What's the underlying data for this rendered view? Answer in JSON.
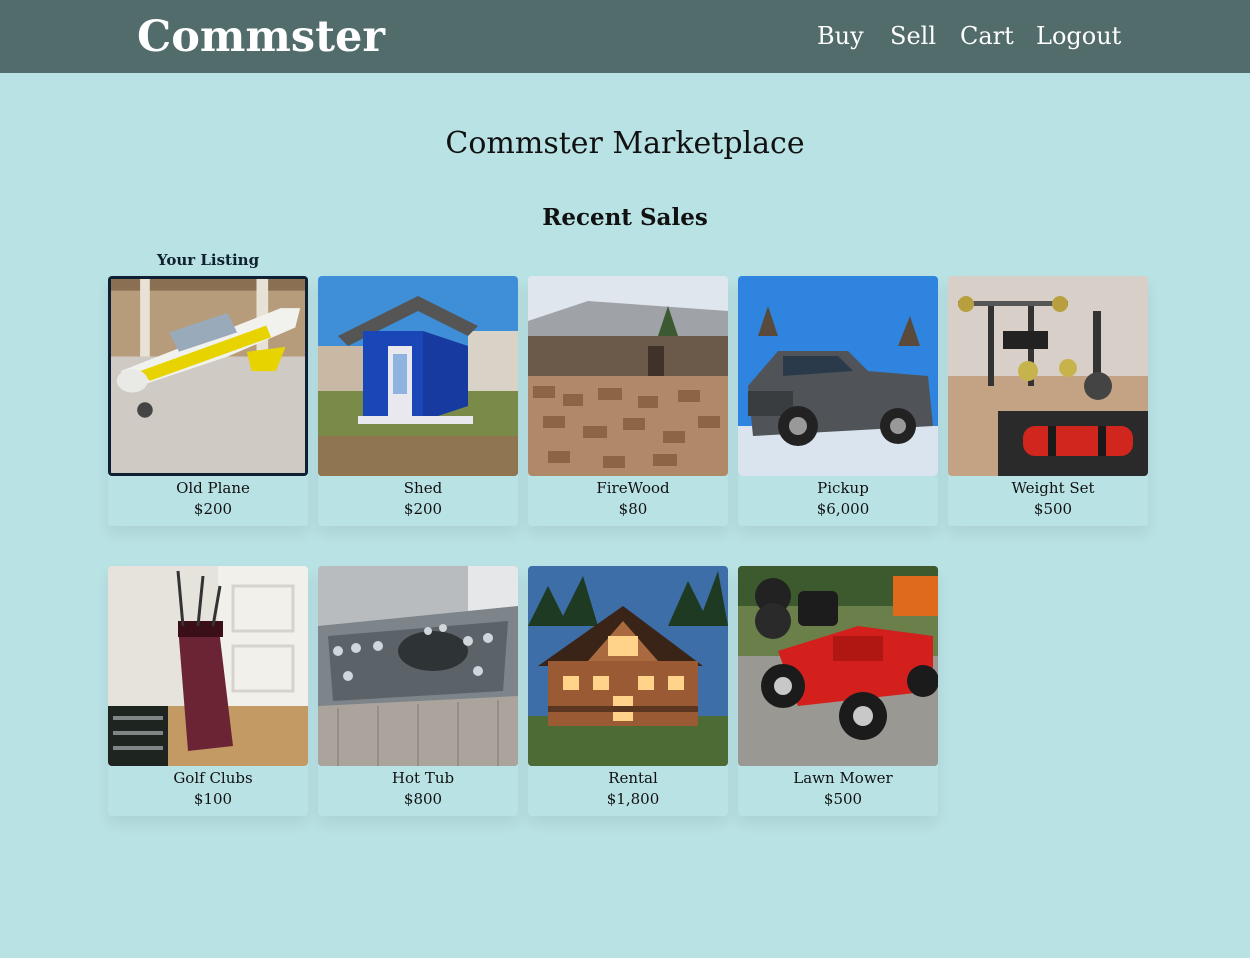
{
  "nav": {
    "brand": "Commster",
    "links": [
      "Buy",
      "Sell",
      "Cart",
      "Logout"
    ]
  },
  "page_title": "Commster Marketplace",
  "section_title": "Recent Sales",
  "your_listing_label": "Your Listing",
  "colors": {
    "background": "#b9e2e5",
    "navbar": "#526c6c",
    "own_listing_border": "#0f2035"
  },
  "listings": [
    {
      "name": "Old Plane",
      "price": "$200",
      "photo": "small-airplane-photo"
    },
    {
      "name": "Shed",
      "price": "$200",
      "photo": "blue-shed-photo"
    },
    {
      "name": "FireWood",
      "price": "$80",
      "photo": "firewood-pile-photo"
    },
    {
      "name": "Pickup",
      "price": "$6,000",
      "photo": "pickup-truck-photo"
    },
    {
      "name": "Weight Set",
      "price": "$500",
      "photo": "weight-set-photo"
    },
    {
      "name": "Golf Clubs",
      "price": "$100",
      "photo": "golf-bag-photo"
    },
    {
      "name": "Hot Tub",
      "price": "$800",
      "photo": "hot-tub-photo"
    },
    {
      "name": "Rental",
      "price": "$1,800",
      "photo": "cabin-house-photo"
    },
    {
      "name": "Lawn Mower",
      "price": "$500",
      "photo": "riding-mower-photo"
    }
  ]
}
